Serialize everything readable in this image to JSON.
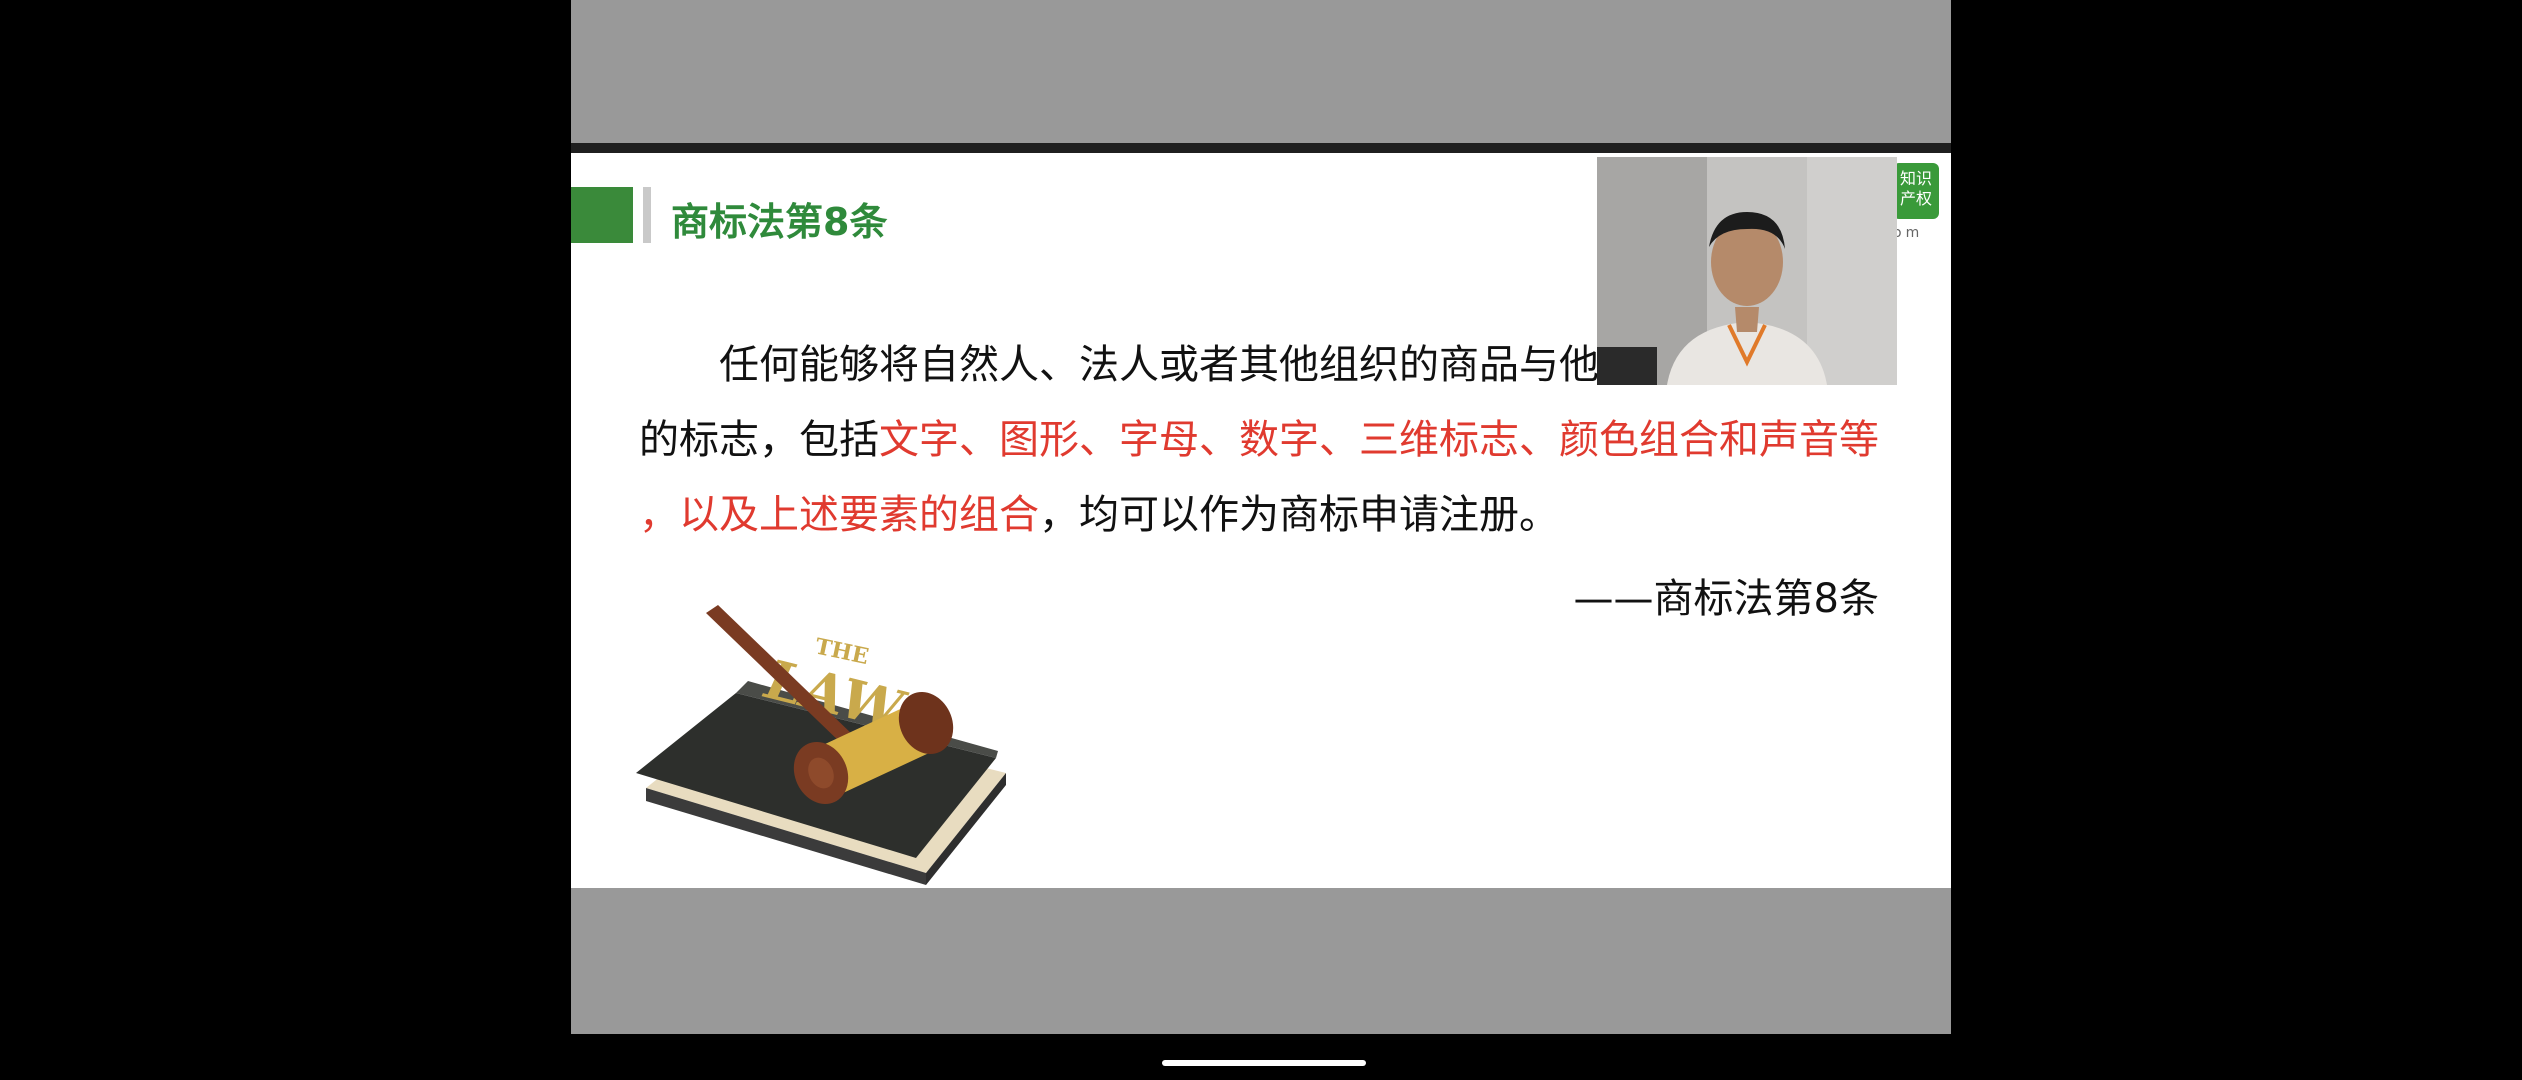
{
  "slide": {
    "title": "商标法第8条",
    "logo_text": "知识产权",
    "logo_sub": "om",
    "body": {
      "part1": "任何能够将自然人、法人或者其他组织的商品与他",
      "part2": "的标志，包括",
      "highlight1": "文字、图形、字母、数字、三维标志、颜色组合和声音等",
      "highlight2": "，以及上述要素的组合",
      "part3": "，均可以作为商标申请注册。"
    },
    "citation": "——商标法第8条",
    "image_caption": "THE LAW"
  },
  "colors": {
    "accent_green": "#2f8a3b",
    "highlight_red": "#e03a2f",
    "frame_gray": "#999999"
  }
}
